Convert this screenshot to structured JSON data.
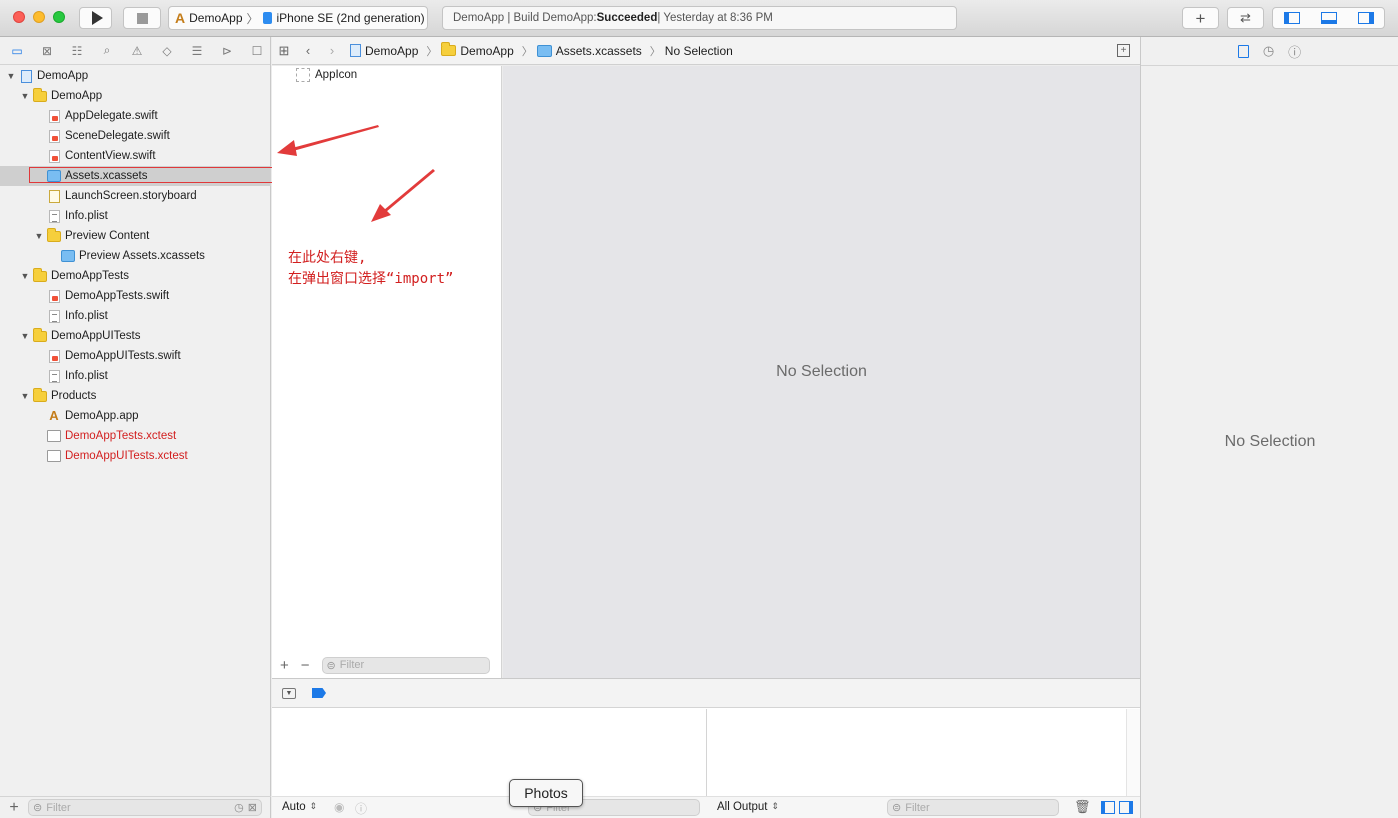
{
  "toolbar": {
    "scheme_target": "DemoApp",
    "scheme_device": "iPhone SE (2nd generation)",
    "status_prefix": "DemoApp | Build DemoApp: ",
    "status_result": "Succeeded",
    "status_suffix": " | Yesterday at 8:36 PM"
  },
  "navigator": {
    "tabs": [
      "folder-icon",
      "source-control-icon",
      "symbol-icon",
      "find-icon",
      "issue-icon",
      "test-icon",
      "debug-icon",
      "breakpoint-icon",
      "report-icon"
    ],
    "items": [
      {
        "label": "DemoApp",
        "type": "project",
        "level": 0,
        "expanded": true
      },
      {
        "label": "DemoApp",
        "type": "folder",
        "level": 1,
        "expanded": true
      },
      {
        "label": "AppDelegate.swift",
        "type": "swift",
        "level": 2
      },
      {
        "label": "SceneDelegate.swift",
        "type": "swift",
        "level": 2
      },
      {
        "label": "ContentView.swift",
        "type": "swift",
        "level": 2
      },
      {
        "label": "Assets.xcassets",
        "type": "assets",
        "level": 2,
        "selected": true
      },
      {
        "label": "LaunchScreen.storyboard",
        "type": "storyboard",
        "level": 2
      },
      {
        "label": "Info.plist",
        "type": "plist",
        "level": 2
      },
      {
        "label": "Preview Content",
        "type": "folder",
        "level": 2,
        "expanded": true
      },
      {
        "label": "Preview Assets.xcassets",
        "type": "assets",
        "level": 3
      },
      {
        "label": "DemoAppTests",
        "type": "folder",
        "level": 1,
        "expanded": true
      },
      {
        "label": "DemoAppTests.swift",
        "type": "swift",
        "level": 2
      },
      {
        "label": "Info.plist",
        "type": "plist",
        "level": 2
      },
      {
        "label": "DemoAppUITests",
        "type": "folder",
        "level": 1,
        "expanded": true
      },
      {
        "label": "DemoAppUITests.swift",
        "type": "swift",
        "level": 2
      },
      {
        "label": "Info.plist",
        "type": "plist",
        "level": 2
      },
      {
        "label": "Products",
        "type": "folder",
        "level": 1,
        "expanded": true
      },
      {
        "label": "DemoApp.app",
        "type": "app",
        "level": 2
      },
      {
        "label": "DemoAppTests.xctest",
        "type": "xctest",
        "level": 2,
        "missing": true
      },
      {
        "label": "DemoAppUITests.xctest",
        "type": "xctest",
        "level": 2,
        "missing": true
      }
    ],
    "filter_placeholder": "Filter"
  },
  "jumpbar": {
    "crumbs": [
      "DemoApp",
      "DemoApp",
      "Assets.xcassets",
      "No Selection"
    ]
  },
  "asset_list": {
    "items": [
      "AppIcon"
    ],
    "filter_placeholder": "Filter"
  },
  "annotation": {
    "line1": "在此处右键,",
    "line2": "在弹出窗口选择“import”",
    "color": "#d21f1f"
  },
  "editor": {
    "empty_text": "No Selection"
  },
  "debug": {
    "auto_label": "Auto",
    "filter_placeholder": "Filter",
    "output_label": "All Output",
    "output_filter_placeholder": "Filter",
    "tooltip": "Photos"
  },
  "inspector": {
    "empty_text": "No Selection"
  },
  "colors": {
    "accent": "#1c79e7",
    "missing_file": "#d21f1f",
    "highlight_border": "#e0383a"
  }
}
